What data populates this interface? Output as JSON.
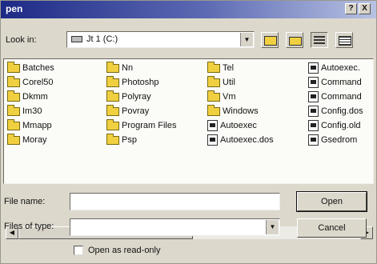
{
  "window": {
    "title": "pen"
  },
  "title_buttons": {
    "help": "?",
    "close": "X"
  },
  "look_in": {
    "label": "Look in:",
    "value": "Jt 1 (C:)"
  },
  "files": [
    {
      "name": "Batches",
      "type": "folder"
    },
    {
      "name": "Corel50",
      "type": "folder"
    },
    {
      "name": "Dkmm",
      "type": "folder"
    },
    {
      "name": "Im30",
      "type": "folder"
    },
    {
      "name": "Mmapp",
      "type": "folder"
    },
    {
      "name": "Moray",
      "type": "folder"
    },
    {
      "name": "Nn",
      "type": "folder"
    },
    {
      "name": "Photoshp",
      "type": "folder"
    },
    {
      "name": "Polyray",
      "type": "folder"
    },
    {
      "name": "Povray",
      "type": "folder"
    },
    {
      "name": "Program Files",
      "type": "folder"
    },
    {
      "name": "Psp",
      "type": "folder"
    },
    {
      "name": "Tel",
      "type": "folder"
    },
    {
      "name": "Util",
      "type": "folder"
    },
    {
      "name": "Vm",
      "type": "folder"
    },
    {
      "name": "Windows",
      "type": "folder"
    },
    {
      "name": "Autoexec",
      "type": "file"
    },
    {
      "name": "Autoexec.dos",
      "type": "file"
    },
    {
      "name": "Autoexec.",
      "type": "file"
    },
    {
      "name": "Command",
      "type": "file"
    },
    {
      "name": "Command",
      "type": "file"
    },
    {
      "name": "Config.dos",
      "type": "file"
    },
    {
      "name": "Config.old",
      "type": "file"
    },
    {
      "name": "Gsedrom",
      "type": "file"
    }
  ],
  "file_name": {
    "label": "File name:",
    "value": ""
  },
  "files_of_type": {
    "label": "Files of type:",
    "value": ""
  },
  "buttons": {
    "open": "Open",
    "cancel": "Cancel"
  },
  "read_only": {
    "label": "Open as read-only",
    "checked": false
  }
}
